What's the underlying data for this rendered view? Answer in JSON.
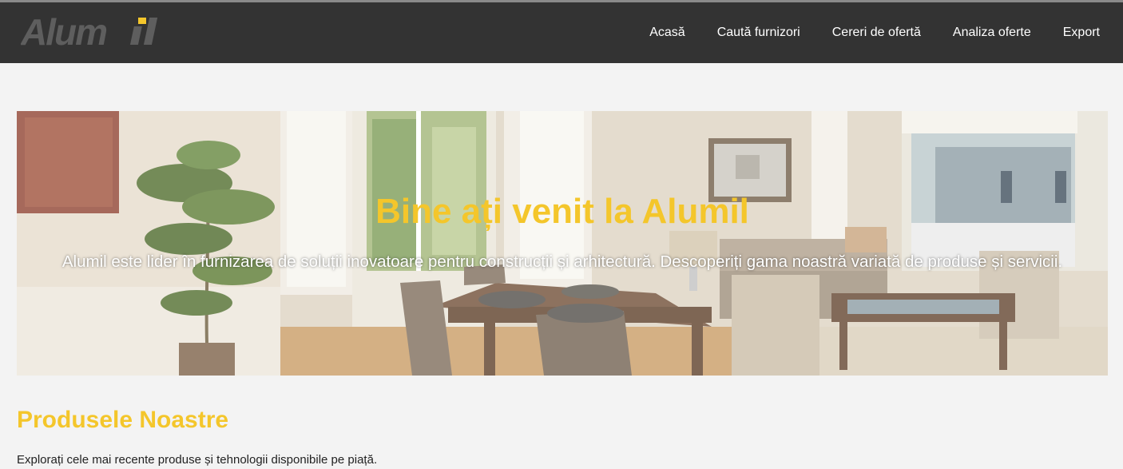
{
  "brand": {
    "logo_text": "Alumil",
    "logo_color": "#5e5e5e",
    "accent_color": "#f4c62b"
  },
  "nav": {
    "items": [
      {
        "label": "Acasă"
      },
      {
        "label": "Caută furnizori"
      },
      {
        "label": "Cereri de ofertă"
      },
      {
        "label": "Analiza oferte"
      },
      {
        "label": "Export"
      }
    ]
  },
  "hero": {
    "title": "Bine ați venit la Alumil",
    "text": "Alumil este lider în furnizarea de soluții inovatoare pentru construcții și arhitectură. Descoperiți gama noastră variată de produse și servicii."
  },
  "products": {
    "title": "Produsele Noastre",
    "text": "Explorați cele mai recente produse și tehnologii disponibile pe piață."
  }
}
